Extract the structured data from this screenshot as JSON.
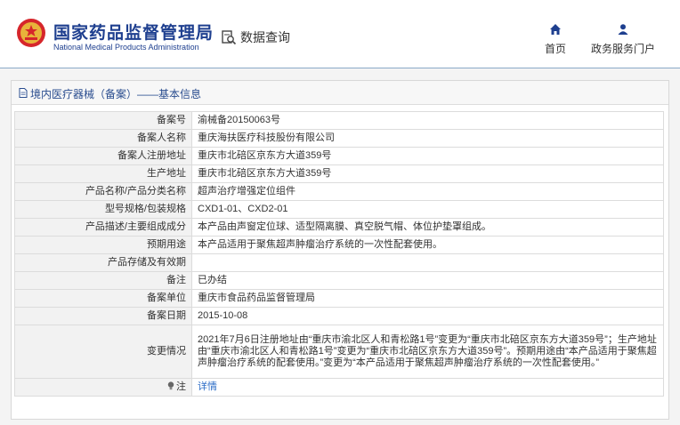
{
  "header": {
    "brand_cn": "国家药品监督管理局",
    "brand_en": "National Medical Products Administration",
    "search_label": "数据查询",
    "nav": [
      {
        "label": "首页",
        "icon": "home-icon"
      },
      {
        "label": "政务服务门户",
        "icon": "user-icon"
      }
    ]
  },
  "colors": {
    "brand": "#1e3f8f",
    "link": "#2a6bc6",
    "label_bg": "#f2f2f2"
  },
  "panel": {
    "title": "境内医疗器械（备案）——基本信息"
  },
  "rows": [
    {
      "label": "备案号",
      "value": "渝械备20150063号"
    },
    {
      "label": "备案人名称",
      "value": "重庆海扶医疗科技股份有限公司"
    },
    {
      "label": "备案人注册地址",
      "value": "重庆市北碚区京东方大道359号"
    },
    {
      "label": "生产地址",
      "value": "重庆市北碚区京东方大道359号"
    },
    {
      "label": "产品名称/产品分类名称",
      "value": "超声治疗增强定位组件"
    },
    {
      "label": "型号规格/包装规格",
      "value": "CXD1-01、CXD2-01"
    },
    {
      "label": "产品描述/主要组成成分",
      "value": "本产品由声窗定位球、适型隔离膜、真空脱气帽、体位护垫罩组成。"
    },
    {
      "label": "预期用途",
      "value": "本产品适用于聚焦超声肿瘤治疗系统的一次性配套使用。"
    },
    {
      "label": "产品存储及有效期",
      "value": ""
    },
    {
      "label": "备注",
      "value": "已办结"
    },
    {
      "label": "备案单位",
      "value": "重庆市食品药品监督管理局"
    },
    {
      "label": "备案日期",
      "value": "2015-10-08"
    },
    {
      "label": "变更情况",
      "value": "2021年7月6日注册地址由“重庆市渝北区人和青松路1号”变更为“重庆市北碚区京东方大道359号”；生产地址由“重庆市渝北区人和青松路1号”变更为“重庆市北碚区京东方大道359号”。预期用途由“本产品适用于聚焦超声肿瘤治疗系统的配套使用。”变更为“本产品适用于聚焦超声肿瘤治疗系统的一次性配套使用。”"
    }
  ],
  "note_row": {
    "label": "注",
    "link": "详情",
    "icon": "lightbulb-icon"
  }
}
